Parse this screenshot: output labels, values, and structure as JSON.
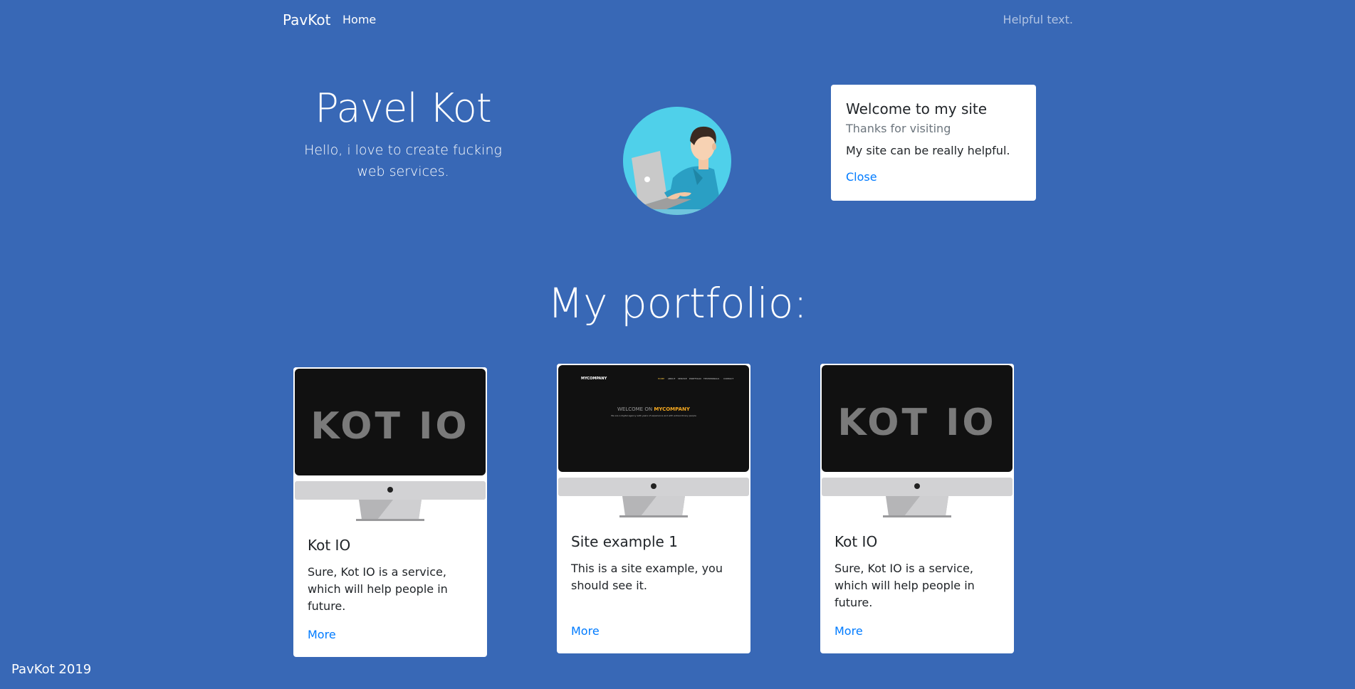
{
  "nav": {
    "brand": "PavKot",
    "home": "Home",
    "helpful": "Helpful text."
  },
  "hero": {
    "name": "Pavel Kot",
    "subtitle": "Hello, i love to create fucking web services."
  },
  "welcome_card": {
    "title": "Welcome to my site",
    "subtitle": "Thanks for visiting",
    "text": "My site can be really helpful.",
    "close": "Close"
  },
  "portfolio": {
    "title": "My portfolio:",
    "cards": [
      {
        "screen_label": "KOT IO",
        "title": "Kot IO",
        "text": "Sure, Kot IO is a service, which will help people in future.",
        "link": "More"
      },
      {
        "screen_brand": "MYCOMPANY",
        "screen_nav": [
          "HOME",
          "ABOUT",
          "SERVICE",
          "PORTFOLIO",
          "TESTIMONIALS",
          "CONTACT"
        ],
        "screen_heading_a": "WELCOME ON ",
        "screen_heading_b": "MYCOMPANY",
        "screen_tagline": "We are a digital agency with years of experience and with extraordinary people",
        "title": "Site example 1",
        "text": "This is a site example, you should see it.",
        "link": "More"
      },
      {
        "screen_label": "KOT IO",
        "title": "Kot IO",
        "text": "Sure, Kot IO is a service, which will help people in future.",
        "link": "More"
      }
    ]
  },
  "footer": {
    "text": "PavKot 2019"
  },
  "colors": {
    "background": "#3868b6",
    "link": "#007bff",
    "avatar_bg": "#4fd0ea"
  }
}
